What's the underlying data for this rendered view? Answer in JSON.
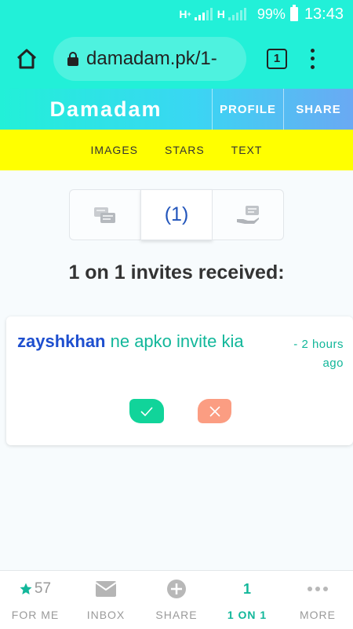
{
  "status_bar": {
    "network_1": "H",
    "network_1_sup": "+",
    "network_2": "H",
    "battery": "99%",
    "time": "13:43"
  },
  "browser": {
    "url": "damadam.pk/1-",
    "tab_count": "1"
  },
  "site": {
    "logo": "Damadam",
    "profile_label": "PROFILE",
    "share_label": "SHARE"
  },
  "yellow_nav": {
    "items": [
      "IMAGES",
      "STARS",
      "TEXT"
    ]
  },
  "segment": {
    "middle_label": "(1)"
  },
  "section_title": "1 on 1 invites received:",
  "invite": {
    "username": "zayshkhan",
    "message": " ne apko invite kia",
    "time_ago": "- 2 hours ago"
  },
  "bottom_nav": {
    "items": [
      {
        "top": "57",
        "label": "FOR ME"
      },
      {
        "top": "",
        "label": "INBOX"
      },
      {
        "top": "",
        "label": "SHARE"
      },
      {
        "top": "1",
        "label": "1 ON 1"
      },
      {
        "top": "",
        "label": "MORE"
      }
    ]
  },
  "colors": {
    "accent": "#22f0d8",
    "teal_text": "#12b79a",
    "user_blue": "#1e4fcf",
    "yellow": "#ffff00",
    "accept": "#11d49a",
    "reject": "#fb9d82"
  }
}
